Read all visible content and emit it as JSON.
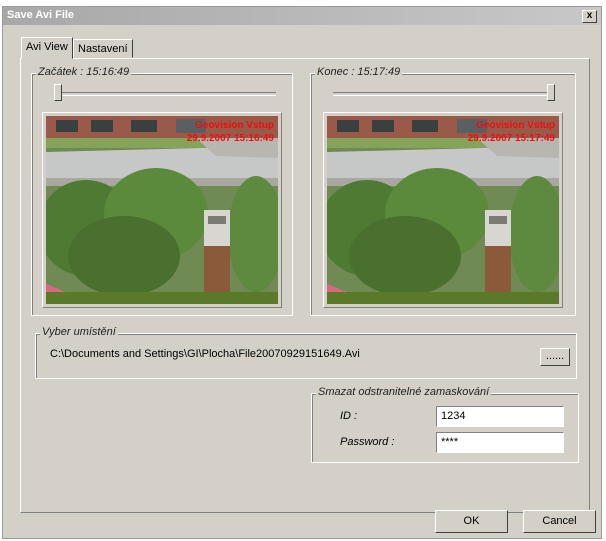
{
  "window": {
    "title": "Save Avi File",
    "close_label": "x"
  },
  "tabs": [
    {
      "label": "Avi View"
    },
    {
      "label": "Nastavení"
    }
  ],
  "start": {
    "label": "Začátek : 15:16:49",
    "slider_fraction": 0.0
  },
  "end": {
    "label": "Konec : 15:17:49",
    "slider_fraction": 1.0
  },
  "previews": [
    {
      "overlay_line1": "Geovision Vstup",
      "overlay_line2": "29.9.2007 15:16:49"
    },
    {
      "overlay_line1": "Geovision Vstup",
      "overlay_line2": "29.9.2007 15:17:49"
    }
  ],
  "location": {
    "label": "Vyber umístění",
    "path": "C:\\Documents and Settings\\GI\\Plocha\\File20070929151649.Avi",
    "browse_label": "......"
  },
  "mask": {
    "label": "Smazat odstranitelné zamaskování",
    "id_label": "ID :",
    "id_value": "1234",
    "password_label": "Password :",
    "password_value": "****"
  },
  "buttons": {
    "ok": "OK",
    "cancel": "Cancel"
  },
  "colors": {
    "overlay_text": "#e81010",
    "titlebar": "#b0b0b0",
    "dialog_bg": "#d4d0c8"
  }
}
